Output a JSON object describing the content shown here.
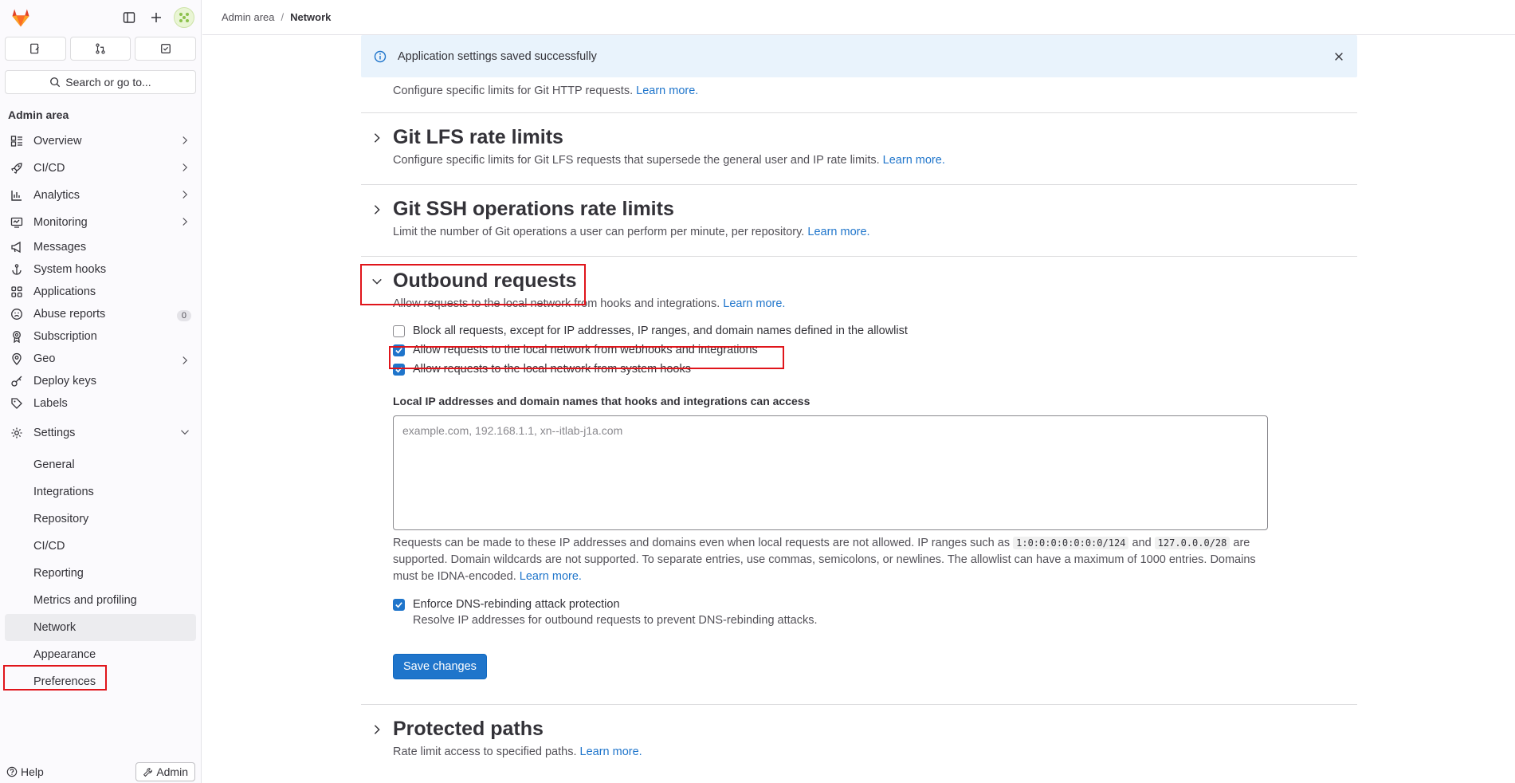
{
  "topbar": {
    "crumb_admin": "Admin area",
    "crumb_current": "Network"
  },
  "sidebar": {
    "search_label": "Search or go to...",
    "section_title": "Admin area",
    "items": [
      {
        "label": "Overview",
        "icon": "overview-icon"
      },
      {
        "label": "CI/CD",
        "icon": "rocket-icon"
      },
      {
        "label": "Analytics",
        "icon": "chart-icon"
      },
      {
        "label": "Monitoring",
        "icon": "monitor-icon"
      },
      {
        "label": "Messages",
        "icon": "bullhorn-icon"
      },
      {
        "label": "System hooks",
        "icon": "anchor-icon"
      },
      {
        "label": "Applications",
        "icon": "grid-icon"
      },
      {
        "label": "Abuse reports",
        "icon": "face-icon",
        "badge": "0"
      },
      {
        "label": "Subscription",
        "icon": "award-icon"
      },
      {
        "label": "Geo",
        "icon": "location-icon"
      },
      {
        "label": "Deploy keys",
        "icon": "key-icon"
      },
      {
        "label": "Labels",
        "icon": "label-icon"
      },
      {
        "label": "Settings",
        "icon": "gear-icon"
      }
    ],
    "settings_sub": [
      "General",
      "Integrations",
      "Repository",
      "CI/CD",
      "Reporting",
      "Metrics and profiling",
      "Network",
      "Appearance",
      "Preferences"
    ],
    "help_label": "Help",
    "admin_label": "Admin"
  },
  "alert": {
    "message": "Application settings saved successfully"
  },
  "partial_section": {
    "desc": "Configure specific limits for Git HTTP requests.",
    "link": "Learn more."
  },
  "sections": {
    "git_lfs": {
      "title": "Git LFS rate limits",
      "desc": "Configure specific limits for Git LFS requests that supersede the general user and IP rate limits.",
      "link": "Learn more."
    },
    "git_ssh": {
      "title": "Git SSH operations rate limits",
      "desc": "Limit the number of Git operations a user can perform per minute, per repository.",
      "link": "Learn more."
    },
    "outbound": {
      "title": "Outbound requests",
      "desc": "Allow requests to the local network from hooks and integrations.",
      "link": "Learn more.",
      "check_block": "Block all requests, except for IP addresses, IP ranges, and domain names defined in the allowlist",
      "check_webhooks": "Allow requests to the local network from webhooks and integrations",
      "check_system": "Allow requests to the local network from system hooks",
      "field_label": "Local IP addresses and domain names that hooks and integrations can access",
      "placeholder": "example.com, 192.168.1.1, xn--itlab-j1a.com",
      "help_1": "Requests can be made to these IP addresses and domains even when local requests are not allowed. IP ranges such as",
      "code_1": "1:0:0:0:0:0:0:0/124",
      "help_and": "and",
      "code_2": "127.0.0.0/28",
      "help_2": "are supported. Domain wildcards are not supported. To separate entries, use commas, semicolons, or newlines. The allowlist can have a maximum of 1000 entries. Domains must be IDNA-encoded.",
      "help_link": "Learn more.",
      "dns_label": "Enforce DNS-rebinding attack protection",
      "dns_help": "Resolve IP addresses for outbound requests to prevent DNS-rebinding attacks.",
      "save": "Save changes"
    },
    "protected": {
      "title": "Protected paths",
      "desc": "Rate limit access to specified paths.",
      "link": "Learn more."
    }
  },
  "colors": {
    "accent": "#1f75cb",
    "highlight": "#e0151b",
    "alert_bg": "#e9f3fc"
  }
}
